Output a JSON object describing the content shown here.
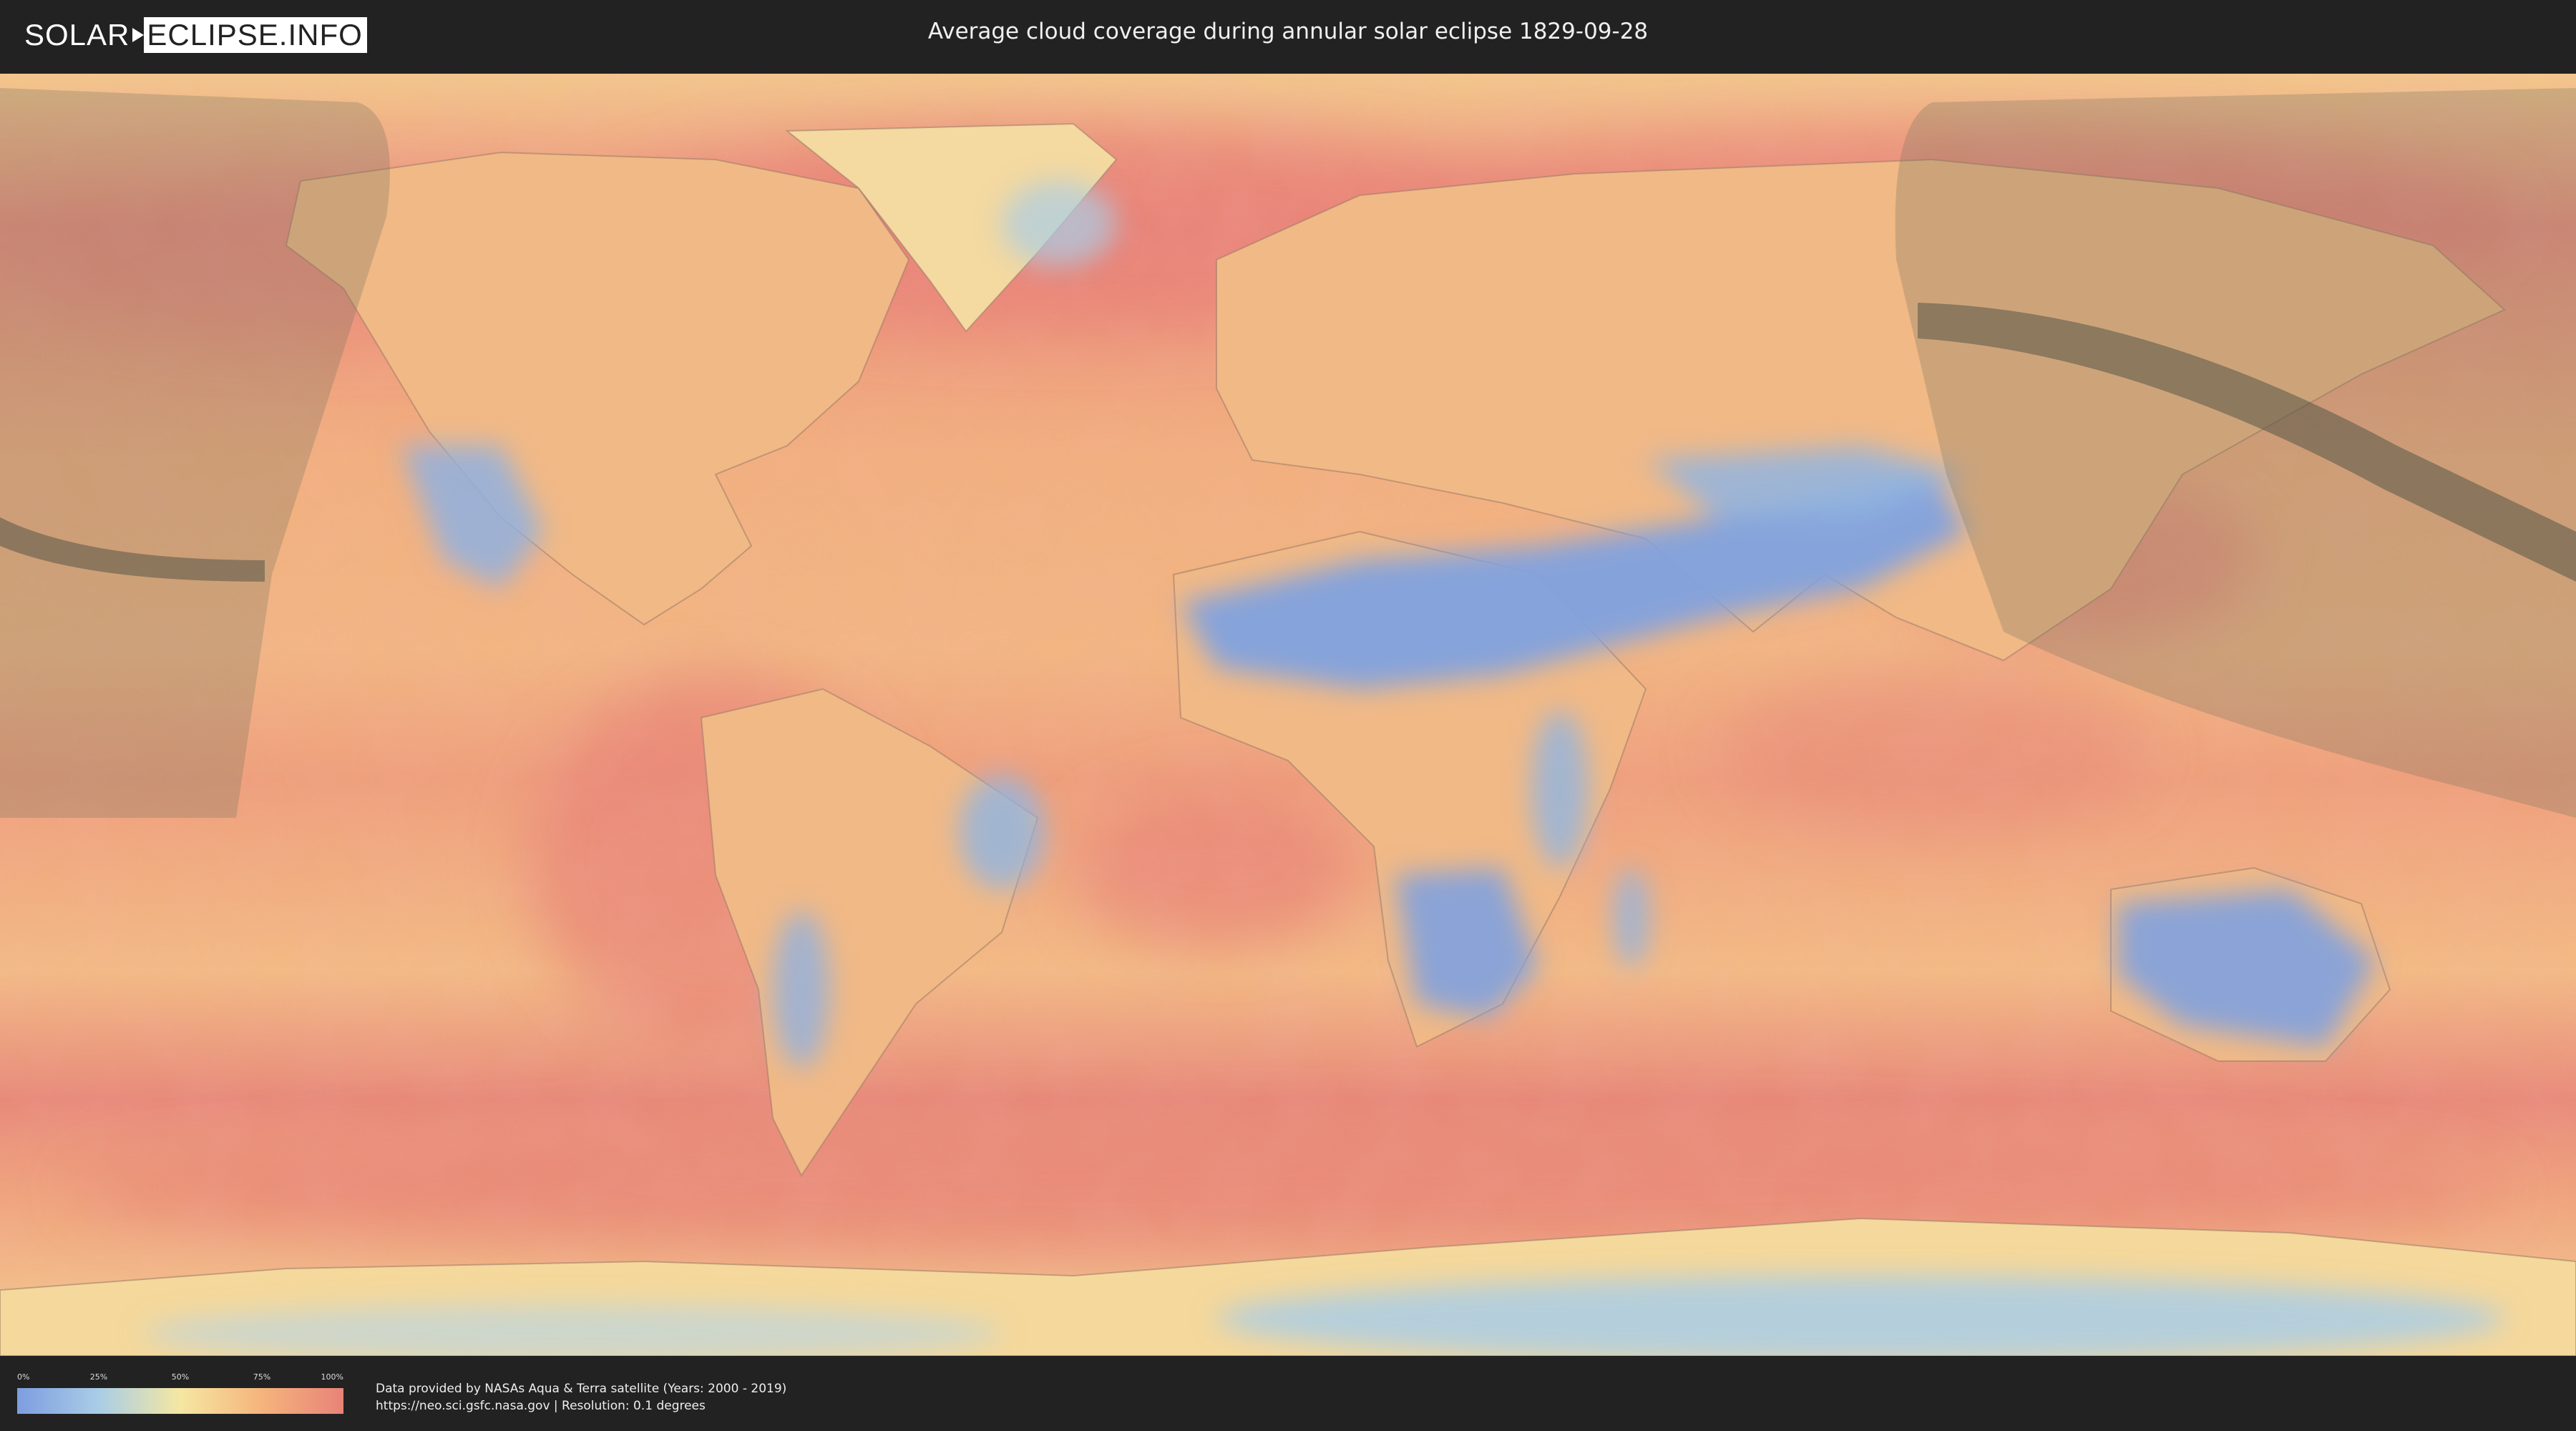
{
  "header": {
    "logo_left": "SOLAR",
    "logo_right": "ECLIPSE.INFO",
    "title": "Average cloud coverage during annular solar eclipse 1829-09-28"
  },
  "legend": {
    "labels": [
      "0%",
      "25%",
      "50%",
      "75%",
      "100%"
    ],
    "stops": [
      0,
      25,
      50,
      75,
      100
    ],
    "colors": [
      "#7d9de0",
      "#a9cde6",
      "#f5e7a2",
      "#f5b47c",
      "#e88378"
    ]
  },
  "footer": {
    "attribution_line1": "Data provided by NASAs Aqua & Terra satellite (Years: 2000 - 2019)",
    "attribution_line2": "https://neo.sci.gsfc.nasa.gov | Resolution: 0.1 degrees"
  },
  "map": {
    "ocean_color": "#f2b27f",
    "land_color": "#f3c289",
    "cloudy_color": "#e98377",
    "clear_color": "#7fa1df",
    "eclipse_shadow_color": "#6f6f5e"
  }
}
